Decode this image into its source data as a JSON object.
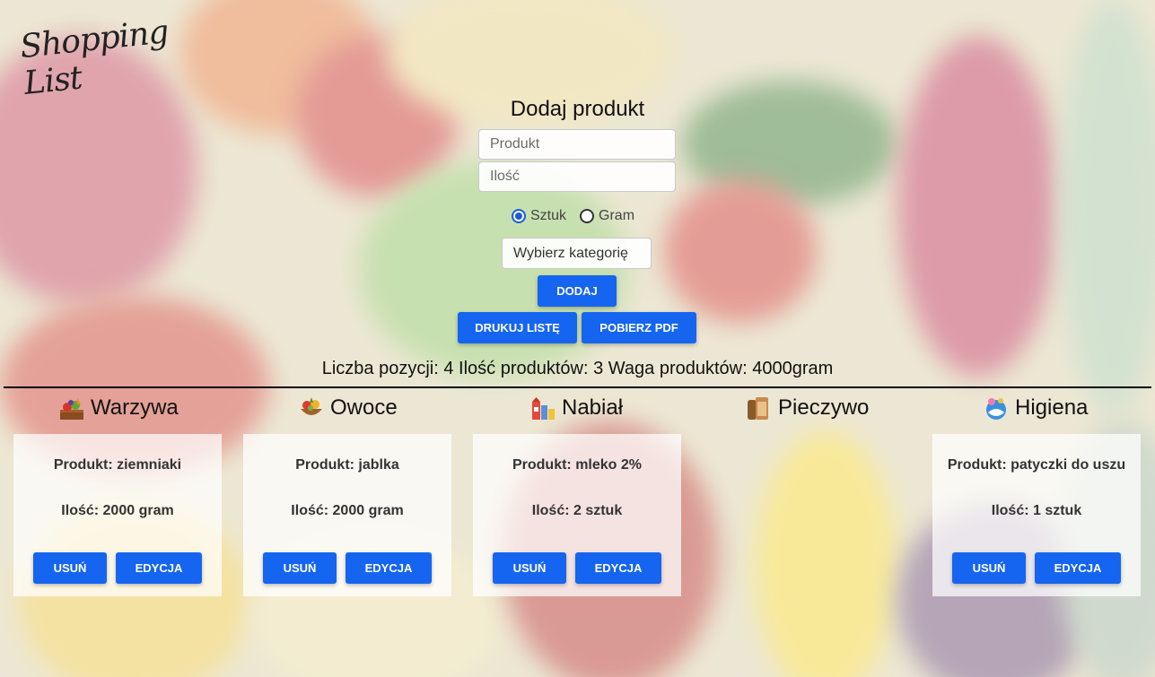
{
  "logo": {
    "text": "Shopping List"
  },
  "form": {
    "title": "Dodaj produkt",
    "product_placeholder": "Produkt",
    "qty_placeholder": "Ilość",
    "unit_options": [
      {
        "label": "Sztuk",
        "selected": true
      },
      {
        "label": "Gram",
        "selected": false
      }
    ],
    "category_select": "Wybierz kategorię",
    "add_label": "DODAJ",
    "print_label": "DRUKUJ LISTĘ",
    "pdf_label": "POBIERZ PDF"
  },
  "stats": "Liczba pozycji: 4 Ilość produktów: 3 Waga produktów: 4000gram",
  "categories": [
    {
      "name": "Warzywa",
      "icon": "vegetables-icon",
      "item": {
        "product": "Produkt: ziemniaki",
        "qty": "Ilość: 2000 gram"
      }
    },
    {
      "name": "Owoce",
      "icon": "fruits-icon",
      "item": {
        "product": "Produkt: jablka",
        "qty": "Ilość: 2000 gram"
      }
    },
    {
      "name": "Nabiał",
      "icon": "dairy-icon",
      "item": {
        "product": "Produkt: mleko 2%",
        "qty": "Ilość: 2 sztuk"
      }
    },
    {
      "name": "Pieczywo",
      "icon": "bread-icon",
      "item": null
    },
    {
      "name": "Higiena",
      "icon": "hygiene-icon",
      "item": {
        "product": "Produkt: patyczki do uszu",
        "qty": "Ilość: 1 sztuk"
      }
    }
  ],
  "card_buttons": {
    "delete": "USUŃ",
    "edit": "EDYCJA"
  },
  "colors": {
    "primary": "#1565f0",
    "radio_selected": "#1a5cd8"
  }
}
